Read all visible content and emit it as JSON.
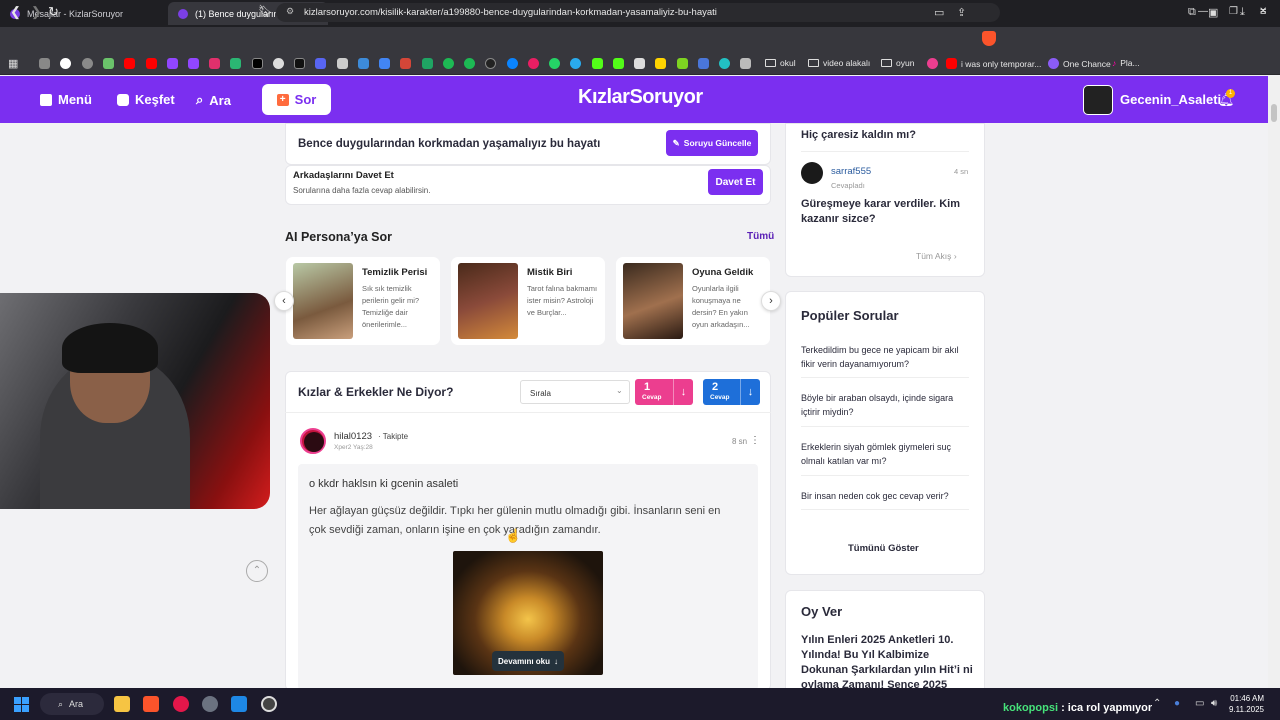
{
  "browser": {
    "tabs": [
      {
        "title": "Mesajlar - KizlarSoruyor",
        "active": false
      },
      {
        "title": "(1) Bence duygularından korkmadan",
        "active": true
      }
    ],
    "url": "kizlarsoruyor.com/kisilik-karakter/a199880-bence-duygularindan-korkmadan-yasamaliyiz-bu-hayati",
    "bookmarks": [
      {
        "label": "okul",
        "type": "folder"
      },
      {
        "label": "video alakalı",
        "type": "folder"
      },
      {
        "label": "oyun",
        "type": "folder"
      },
      {
        "label": "i was only temporar...",
        "type": "link"
      },
      {
        "label": "One Chance",
        "type": "link"
      },
      {
        "label": "Pla...",
        "type": "link"
      }
    ]
  },
  "header": {
    "nav": [
      {
        "label": "Menü"
      },
      {
        "label": "Keşfet"
      },
      {
        "label": "Ara"
      }
    ],
    "ask_label": "Sor",
    "logo": "KızlarSoruyor",
    "username": "Gecenin_Asaleti",
    "notification_count": "1"
  },
  "question": {
    "title": "Bence duygularından korkmadan yaşamalıyız bu hayatı",
    "update_label": "Soruyu Güncelle",
    "invite_title": "Arkadaşlarını Davet Et",
    "invite_sub": "Sorularına daha fazla cevap alabilirsin.",
    "invite_label": "Davet Et"
  },
  "ai_persona": {
    "title": "AI Persona’ya Sor",
    "all_label": "Tümü",
    "cards": [
      {
        "name": "Temizlik Perisi",
        "desc": "Sık sık temizlik perilerin gelir mi? Temizliğe dair önerilerimle..."
      },
      {
        "name": "Mistik Biri",
        "desc": "Tarot falına bakmamı ister misin? Astroloji ve Burçlar..."
      },
      {
        "name": "Oyuna Geldik",
        "desc": "Oyunlarla ilgili konuşmaya ne dersin? En yakın oyun arkadaşın..."
      }
    ]
  },
  "answers": {
    "title": "Kızlar & Erkekler Ne Diyor?",
    "sort_label": "Sırala",
    "girls_count": "1",
    "boys_count": "2",
    "count_label": "Cevap",
    "item": {
      "username": "hilal0123",
      "follow_label": "· Takipte",
      "meta": "Xper2 Yaş:28",
      "time": "8 sn",
      "line1": "o kkdr haklsın ki gcenin asaleti",
      "line2": "Her ağlayan güçsüz değildir. Tıpkı her gülenin mutlu olmadığı gibi. İnsanların seni en çok sevdiği zaman, onların işine en çok yaradığın zamandır.",
      "read_more": "Devamını oku"
    }
  },
  "sidebar": {
    "activity": {
      "q1": "Hiç çaresiz kaldın mı?",
      "user": "sarraf555",
      "time": "4 sn",
      "sub": "Cevapladı",
      "q2": "Güreşmeye karar verdiler. Kim kazanır sizce?",
      "all_label": "Tüm Akış"
    },
    "popular": {
      "title": "Popüler Sorular",
      "items": [
        "Terkedildim bu gece ne yapicam bir akıl fikir verin dayanamıyorum?",
        "Böyle bir araban olsaydı, içinde sigara içtirir miydin?",
        "Erkeklerin siyah gömlek giymeleri suç olmalı katılan var mı?",
        "Bir insan neden cok gec cevap verir?"
      ],
      "all_label": "Tümünü Göster"
    },
    "vote": {
      "title": "Oy Ver",
      "text": "Yılın Enleri 2025 Anketleri 10. Yılında! Bu Yıl Kalbimize Dokunan Şarkılardan yılın Hit’i ni oylama Zamanı! Sence 2025"
    }
  },
  "taskbar": {
    "search_label": "Ara",
    "overlay_name": "kokopopsi",
    "overlay_text": ": ica rol yapmıyor",
    "time": "01:46 AM",
    "date": "9.11.2025"
  }
}
